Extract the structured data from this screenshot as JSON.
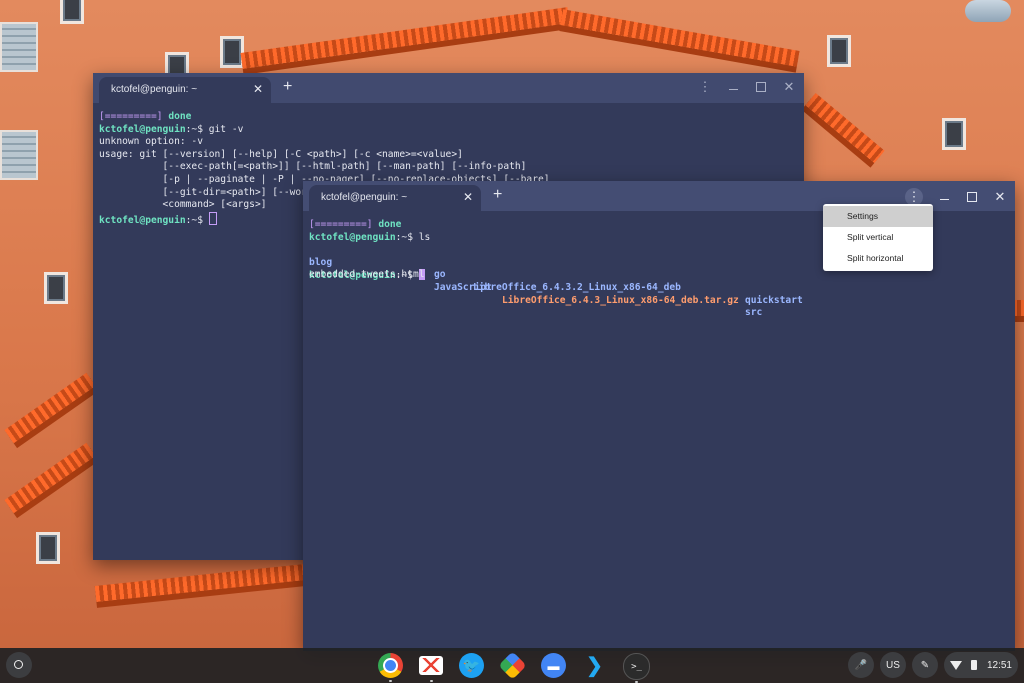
{
  "back_window": {
    "tab_title": "kctofel@penguin: ~",
    "tab_close": "✕",
    "new_tab": "+",
    "menu_icon": "⋮",
    "lines": [
      {
        "prog": "[=========]",
        "status": "done"
      },
      {
        "user": "kctofel@penguin",
        "path": ":~$",
        "cmd": " git -v"
      },
      {
        "text": "unknown option: -v"
      },
      {
        "text": "usage: git [--version] [--help] [-C <path>] [-c <name>=<value>]"
      },
      {
        "text": "           [--exec-path[=<path>]] [--html-path] [--man-path] [--info-path]"
      },
      {
        "text": "           [-p | --paginate | -P | --no-pager] [--no-replace-objects] [--bare]"
      },
      {
        "text": "           [--git-dir=<path>] [--wor"
      },
      {
        "text": "           <command> [<args>]"
      },
      {
        "user": "kctofel@penguin",
        "path": ":~$",
        "cmd": " "
      }
    ]
  },
  "front_window": {
    "tab_title": "kctofel@penguin: ~",
    "tab_close": "✕",
    "new_tab": "+",
    "menu_icon": "⋮",
    "line1_prog": "[=========]",
    "line1_status": "done",
    "line2_user": "kctofel@penguin",
    "line2_path": ":~$",
    "line2_cmd": " ls",
    "ls_row1": [
      "blog",
      "go",
      "LibreOffice_6.4.3.2_Linux_x86-64_deb",
      "quickstart"
    ],
    "ls_row2": [
      "embedded-tweets.html",
      "JavaScript",
      "LibreOffice_6.4.3_Linux_x86-64_deb.tar.gz",
      "src"
    ],
    "line4_user": "kctofel@penguin",
    "line4_path": ":~$"
  },
  "context_menu": {
    "items": [
      "Settings",
      "Split vertical",
      "Split horizontal"
    ],
    "highlighted_index": 0
  },
  "shelf": {
    "apps": [
      "Chrome",
      "Gmail",
      "Twitter",
      "Google Photos",
      "Files",
      "Visual Studio Code",
      "Terminal"
    ],
    "terminal_glyph": ">_",
    "ime": "US",
    "clock": "12:51",
    "twitter_glyph": "🐦",
    "files_glyph": "▬",
    "vscode_glyph": "❯"
  },
  "colors": {
    "terminal_bg": "#333a5a",
    "prompt": "#6fe3c2",
    "directory": "#9bb7ff",
    "archive": "#ff9d6e",
    "progress": "#c59df7"
  }
}
